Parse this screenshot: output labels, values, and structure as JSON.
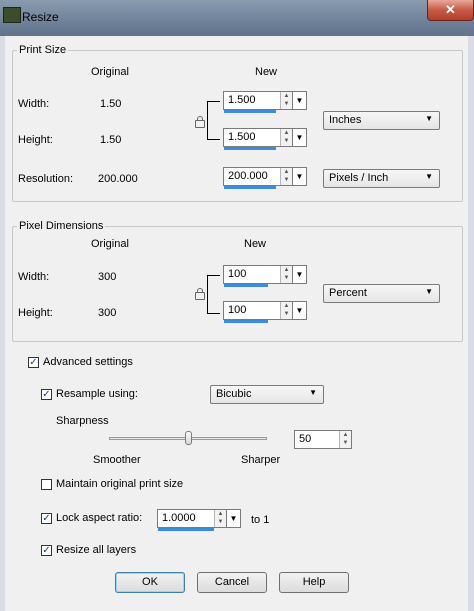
{
  "window": {
    "title": "Resize",
    "close_glyph": "✕"
  },
  "print_size": {
    "group_label": "Print Size",
    "original_header": "Original",
    "new_header": "New",
    "width_label": "Width:",
    "width_original": "1.50",
    "width_new": "1.500",
    "height_label": "Height:",
    "height_original": "1.50",
    "height_new": "1.500",
    "resolution_label": "Resolution:",
    "resolution_original": "200.000",
    "resolution_new": "200.000",
    "units": "Inches",
    "resolution_units": "Pixels / Inch"
  },
  "pixel_dimensions": {
    "group_label": "Pixel Dimensions",
    "original_header": "Original",
    "new_header": "New",
    "width_label": "Width:",
    "width_original": "300",
    "width_new": "100",
    "height_label": "Height:",
    "height_original": "300",
    "height_new": "100",
    "units": "Percent"
  },
  "advanced": {
    "advanced_settings_label": "Advanced settings",
    "advanced_settings_checked": true,
    "resample_label": "Resample using:",
    "resample_checked": true,
    "resample_method": "Bicubic",
    "sharpness_label": "Sharpness",
    "smoother_label": "Smoother",
    "sharper_label": "Sharper",
    "sharpness_value": "50",
    "sharpness_level": 0.5,
    "maintain_print_label": "Maintain original print size",
    "maintain_print_checked": false,
    "lock_aspect_label": "Lock aspect ratio:",
    "lock_aspect_checked": true,
    "aspect_value": "1.0000",
    "aspect_suffix": "to 1",
    "resize_layers_label": "Resize all layers",
    "resize_layers_checked": true
  },
  "buttons": {
    "ok": "OK",
    "cancel": "Cancel",
    "help": "Help"
  },
  "icons": {
    "spin": "spin-arrows-icon",
    "dropdown": "chevron-down-icon",
    "lock": "lock-icon",
    "check": "✓"
  },
  "colors": {
    "accent": "#3c8be0",
    "title_bar": "#6f8299",
    "close": "#c75a45"
  }
}
